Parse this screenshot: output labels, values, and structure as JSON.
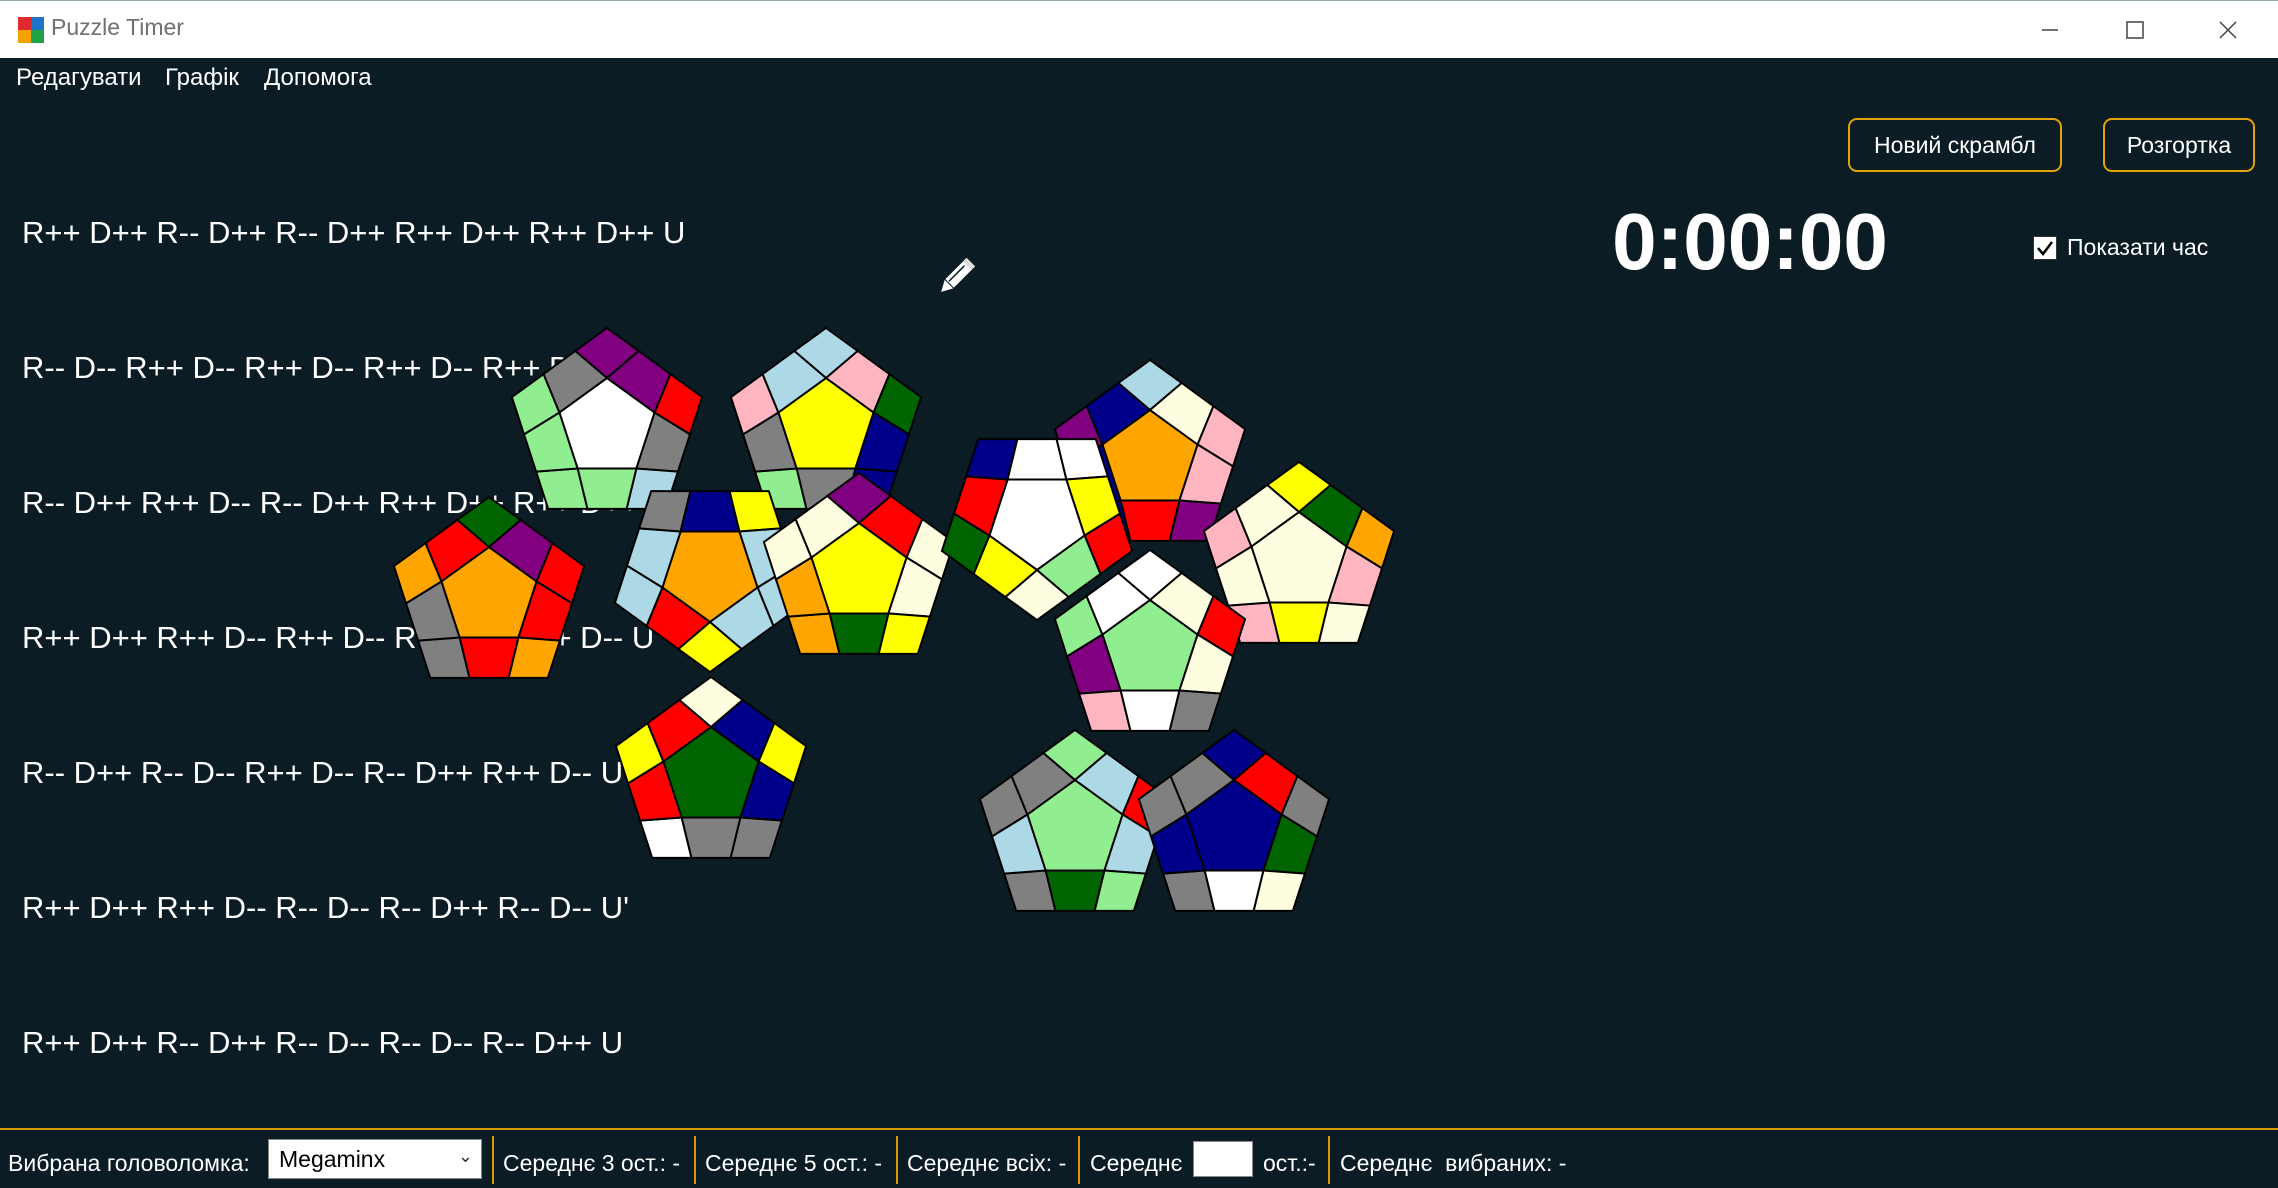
{
  "window": {
    "title": "Puzzle Timer"
  },
  "menu": [
    "Редагувати",
    "Графік",
    "Допомога"
  ],
  "scramble": {
    "lines": [
      "R++ D++ R-- D++ R-- D++ R++ D++ R++ D++ U",
      "R-- D-- R++ D-- R++ D-- R++ D-- R++ D++ U",
      "R-- D++ R++ D-- R-- D++ R++ D++ R++ D++ U",
      "R++ D++ R++ D-- R++ D-- R-- D++ R++ D-- U'",
      "R-- D++ R-- D-- R++ D-- R-- D++ R++ D-- U'",
      "R++ D++ R++ D-- R-- D-- R-- D++ R-- D-- U'",
      "R++ D++ R-- D++ R-- D-- R-- D-- R-- D++ U"
    ]
  },
  "buttons": {
    "new_scramble": "Новий скрамбл",
    "net": "Розгортка"
  },
  "timer": {
    "value": "0:00:00",
    "show_time_label": "Показати час",
    "show_time_checked": true
  },
  "colors": {
    "background": "#0c1c24",
    "accent": "#e3a300",
    "W": "#ffffff",
    "C": "#fffde0",
    "Y": "#ffff00",
    "O": "#ffa500",
    "R": "#ff0000",
    "P": "#ffb6c1",
    "M": "#800080",
    "B": "#00008b",
    "L": "#add8e6",
    "G": "#006400",
    "N": "#90ee90",
    "X": "#808080"
  },
  "faces": [
    [
      "W",
      "M",
      "M",
      "R",
      "X",
      "L",
      "N",
      "N",
      "N",
      "N",
      "X"
    ],
    [
      "Y",
      "L",
      "P",
      "G",
      "B",
      "B",
      "X",
      "N",
      "X",
      "P",
      "L"
    ],
    [
      "O",
      "G",
      "M",
      "R",
      "R",
      "O",
      "R",
      "X",
      "X",
      "O",
      "R"
    ],
    [
      "O",
      "Y",
      "R",
      "L",
      "L",
      "X",
      "B",
      "Y",
      "L",
      "L",
      "L"
    ],
    [
      "Y",
      "M",
      "R",
      "C",
      "C",
      "Y",
      "G",
      "O",
      "O",
      "C",
      "C"
    ],
    [
      "O",
      "L",
      "C",
      "P",
      "P",
      "M",
      "R",
      "B",
      "B",
      "M",
      "B"
    ],
    [
      "C",
      "Y",
      "G",
      "O",
      "P",
      "C",
      "Y",
      "P",
      "C",
      "P",
      "C"
    ],
    [
      "W",
      "C",
      "Y",
      "G",
      "R",
      "B",
      "W",
      "W",
      "Y",
      "R",
      "N"
    ],
    [
      "G",
      "C",
      "B",
      "Y",
      "B",
      "X",
      "X",
      "W",
      "R",
      "Y",
      "R"
    ],
    [
      "N",
      "N",
      "L",
      "R",
      "L",
      "N",
      "G",
      "X",
      "L",
      "X",
      "X"
    ],
    [
      "B",
      "B",
      "R",
      "X",
      "G",
      "C",
      "W",
      "X",
      "B",
      "X",
      "X"
    ],
    [
      "N",
      "W",
      "C",
      "R",
      "C",
      "X",
      "W",
      "P",
      "M",
      "N",
      "W"
    ]
  ],
  "status": {
    "puzzle_label": "Вибрана головоломка:",
    "puzzle_value": "Megaminx",
    "avg3": "Середнє 3 ост.: -",
    "avg5": "Середнє 5 ост.: -",
    "avg_all": "Середнє всіх: -",
    "avg_n_prefix": "Середнє",
    "avg_n_suffix": "ост.:-",
    "avg_selected": "Середнє  вибраних: -"
  }
}
